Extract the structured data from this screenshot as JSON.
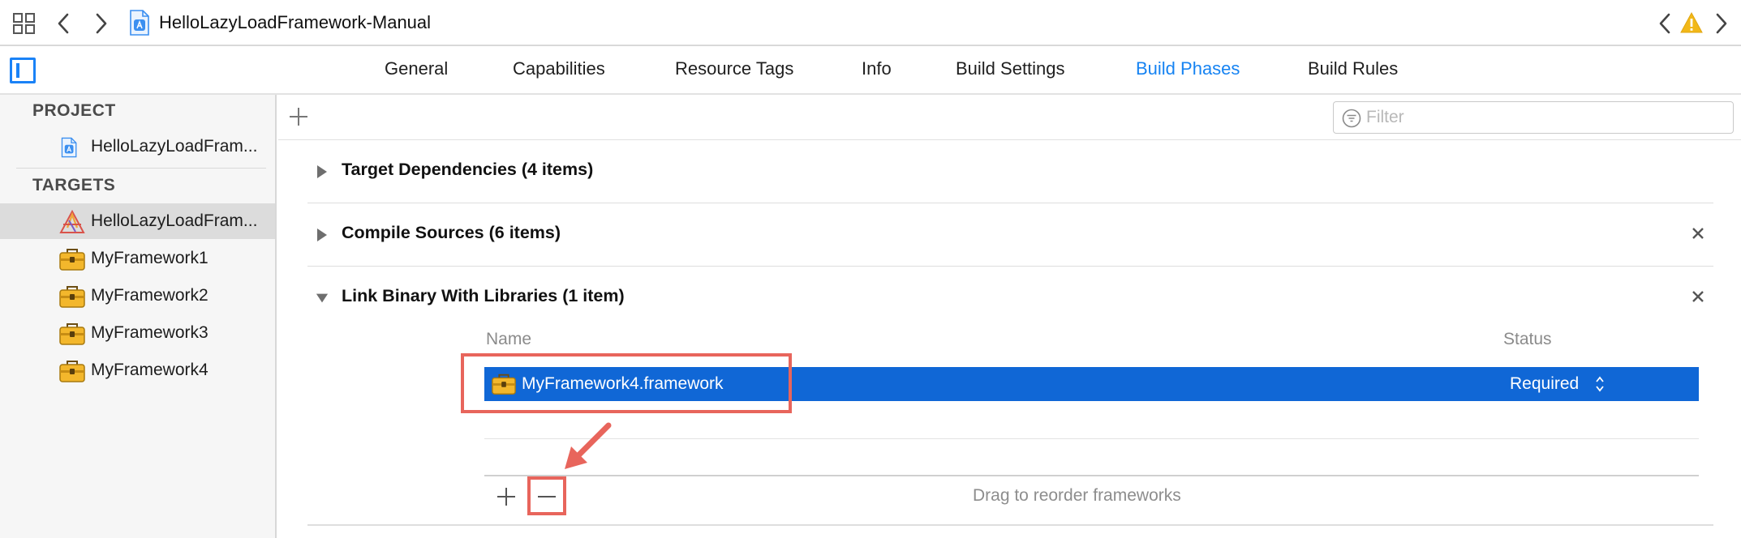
{
  "pathbar": {
    "title": "HelloLazyLoadFramework-Manual",
    "icons": [
      "grid-icon",
      "chevron-left-icon",
      "chevron-right-icon",
      "app-file-icon",
      "chevron-left-icon",
      "warning-icon",
      "chevron-right-icon"
    ],
    "warning_color": "#f2b818"
  },
  "tabs": [
    {
      "label": "General",
      "active": false
    },
    {
      "label": "Capabilities",
      "active": false
    },
    {
      "label": "Resource Tags",
      "active": false
    },
    {
      "label": "Info",
      "active": false
    },
    {
      "label": "Build Settings",
      "active": false
    },
    {
      "label": "Build Phases",
      "active": true
    },
    {
      "label": "Build Rules",
      "active": false
    }
  ],
  "accent_color": "#1683f2",
  "sidebar": {
    "project_header": "PROJECT",
    "project_item": "HelloLazyLoadFram...",
    "targets_header": "TARGETS",
    "targets": [
      {
        "label": "HelloLazyLoadFram...",
        "icon": "app-target-icon",
        "selected": true
      },
      {
        "label": "MyFramework1",
        "icon": "toolbox-icon",
        "selected": false
      },
      {
        "label": "MyFramework2",
        "icon": "toolbox-icon",
        "selected": false
      },
      {
        "label": "MyFramework3",
        "icon": "toolbox-icon",
        "selected": false
      },
      {
        "label": "MyFramework4",
        "icon": "toolbox-icon",
        "selected": false
      }
    ]
  },
  "main": {
    "filter": {
      "placeholder": "Filter",
      "value": ""
    },
    "phases": [
      {
        "title": "Target Dependencies (4 items)",
        "expanded": false,
        "closable": false
      },
      {
        "title": "Compile Sources (6 items)",
        "expanded": false,
        "closable": true
      },
      {
        "title": "Link Binary With Libraries (1 item)",
        "expanded": true,
        "closable": true
      }
    ],
    "libraries": {
      "col_name": "Name",
      "col_status": "Status",
      "rows": [
        {
          "name": "MyFramework4.framework",
          "status": "Required",
          "selected": true
        }
      ],
      "drag_hint": "Drag to reorder frameworks"
    }
  },
  "annotation_color": "#e8655c",
  "selection_color": "#1067d6"
}
